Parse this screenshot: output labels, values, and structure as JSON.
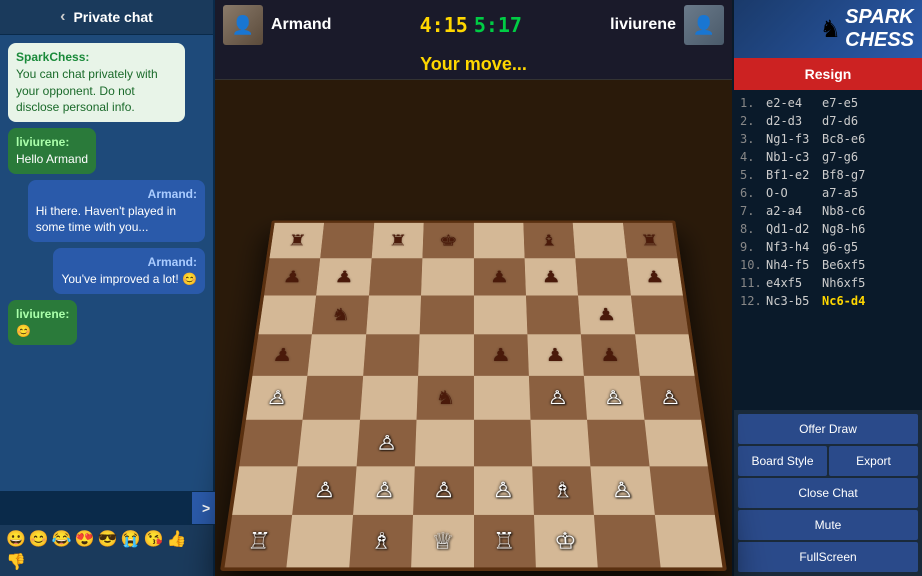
{
  "chat": {
    "header_label": "Private chat",
    "back_icon": "‹",
    "messages": [
      {
        "type": "system",
        "sender": "SparkChess:",
        "text": "You can chat privately with your opponent. Do not disclose personal info."
      },
      {
        "type": "opponent",
        "sender": "liviurene:",
        "text": "Hello Armand"
      },
      {
        "type": "self",
        "sender": "Armand:",
        "text": "Hi there. Haven't played in some time with you..."
      },
      {
        "type": "self",
        "sender": "Armand:",
        "text": "You've improved a lot! 😊"
      },
      {
        "type": "opponent",
        "sender": "liviurene:",
        "text": "😊"
      }
    ],
    "input_placeholder": "",
    "send_label": ">",
    "emojis": [
      "😀",
      "😊",
      "😂",
      "😍",
      "😎",
      "😭",
      "😘",
      "👍",
      "👎"
    ]
  },
  "board": {
    "player_white": "Armand",
    "player_black": "liviurene",
    "timer_white": "4:15",
    "timer_black": "5:17",
    "status": "Your move...",
    "flag_white": "🏳",
    "flag_black": "🏳"
  },
  "moves": [
    {
      "num": "1.",
      "w": "e2-e4",
      "b": "e7-e5"
    },
    {
      "num": "2.",
      "w": "d2-d3",
      "b": "d7-d6"
    },
    {
      "num": "3.",
      "w": "Ng1-f3",
      "b": "Bc8-e6"
    },
    {
      "num": "4.",
      "w": "Nb1-c3",
      "b": "g7-g6"
    },
    {
      "num": "5.",
      "w": "Bf1-e2",
      "b": "Bf8-g7"
    },
    {
      "num": "6.",
      "w": "O-O",
      "b": "a7-a5"
    },
    {
      "num": "7.",
      "w": "a2-a4",
      "b": "Nb8-c6"
    },
    {
      "num": "8.",
      "w": "Qd1-d2",
      "b": "Ng8-h6"
    },
    {
      "num": "9.",
      "w": "Nf3-h4",
      "b": "g6-g5"
    },
    {
      "num": "10.",
      "w": "Nh4-f5",
      "b": "Be6xf5"
    },
    {
      "num": "11.",
      "w": "e4xf5",
      "b": "Nh6xf5"
    },
    {
      "num": "12.",
      "w": "Nc3-b5",
      "b": "Nc6-d4",
      "highlight_b": true
    }
  ],
  "right_panel": {
    "spark_logo": "SPARK CHESS",
    "spark_icon": "♞",
    "resign_label": "Resign",
    "offer_draw_label": "Offer Draw",
    "board_style_label": "Board Style",
    "export_label": "Export",
    "close_chat_label": "Close Chat",
    "mute_label": "Mute",
    "fullscreen_label": "FullScreen"
  }
}
